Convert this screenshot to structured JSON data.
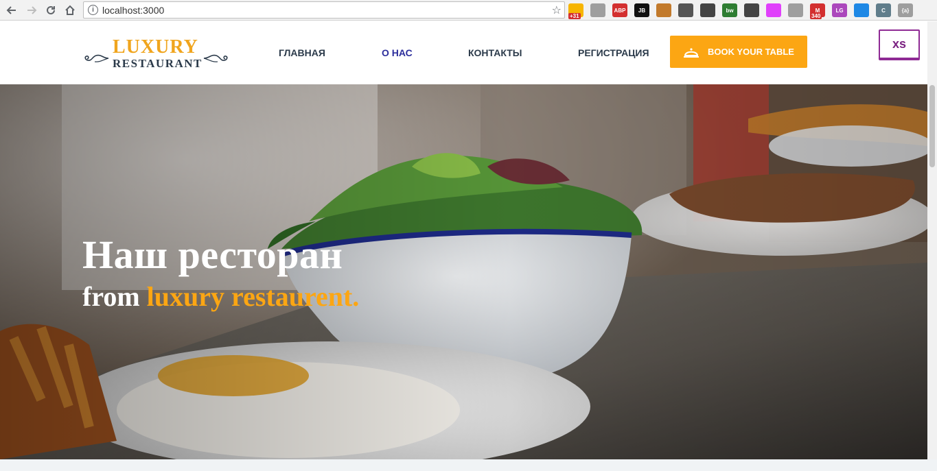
{
  "browser": {
    "url": "localhost:3000",
    "extensions": [
      {
        "name": "calendar-ext-icon",
        "badge": "+31",
        "color": "#f7b500"
      },
      {
        "name": "pdf-ext-icon",
        "badge": "",
        "color": "#9e9e9e"
      },
      {
        "name": "adblock-plus-icon",
        "badge": "",
        "color": "#d32f2f",
        "text": "ABP"
      },
      {
        "name": "jetbrains-icon",
        "badge": "",
        "color": "#111111",
        "text": "JB"
      },
      {
        "name": "ruler-ext-icon",
        "badge": "",
        "color": "#c27a2c"
      },
      {
        "name": "colorpicker-ext-icon",
        "badge": "",
        "color": "#555555"
      },
      {
        "name": "screenshot-ext-icon",
        "badge": "",
        "color": "#444444"
      },
      {
        "name": "bw-ext-icon",
        "badge": "",
        "color": "#2e7d32",
        "text": "bw"
      },
      {
        "name": "sync-ext-icon",
        "badge": "",
        "color": "#444444"
      },
      {
        "name": "gradient-ext-icon",
        "badge": "",
        "color": "#e040fb"
      },
      {
        "name": "layout-ext-icon",
        "badge": "",
        "color": "#9e9e9e"
      },
      {
        "name": "gmail-ext-icon",
        "badge": "340",
        "color": "#d32f2f",
        "text": "M"
      },
      {
        "name": "lg-ext-icon",
        "badge": "",
        "color": "#ab47bc",
        "text": "LG"
      },
      {
        "name": "upload-ext-icon",
        "badge": "",
        "color": "#1e88e5"
      },
      {
        "name": "c-ext-icon",
        "badge": "",
        "color": "#607d8b",
        "text": "C"
      },
      {
        "name": "json-ext-icon",
        "badge": "",
        "color": "#9e9e9e",
        "text": "{a}"
      }
    ]
  },
  "logo": {
    "line1": "LUXURY",
    "line2": "RESTAURANT"
  },
  "nav": {
    "items": [
      {
        "label": "ГЛАВНАЯ",
        "active": false
      },
      {
        "label": "О НАС",
        "active": true
      },
      {
        "label": "КОНТАКТЫ",
        "active": false
      },
      {
        "label": "РЕГИСТРАЦИЯ",
        "active": false
      }
    ],
    "book_label": "BOOK YOUR TABLE"
  },
  "breakpoint_badge": "xs",
  "hero": {
    "title": "Наш ресторан",
    "subtitle_prefix": "from",
    "subtitle_accent": "luxury restaurent."
  },
  "colors": {
    "accent": "#fca613",
    "nav_text": "#2b3a4a",
    "nav_active": "#2c2e9c",
    "badge_border": "#8e2a94"
  }
}
